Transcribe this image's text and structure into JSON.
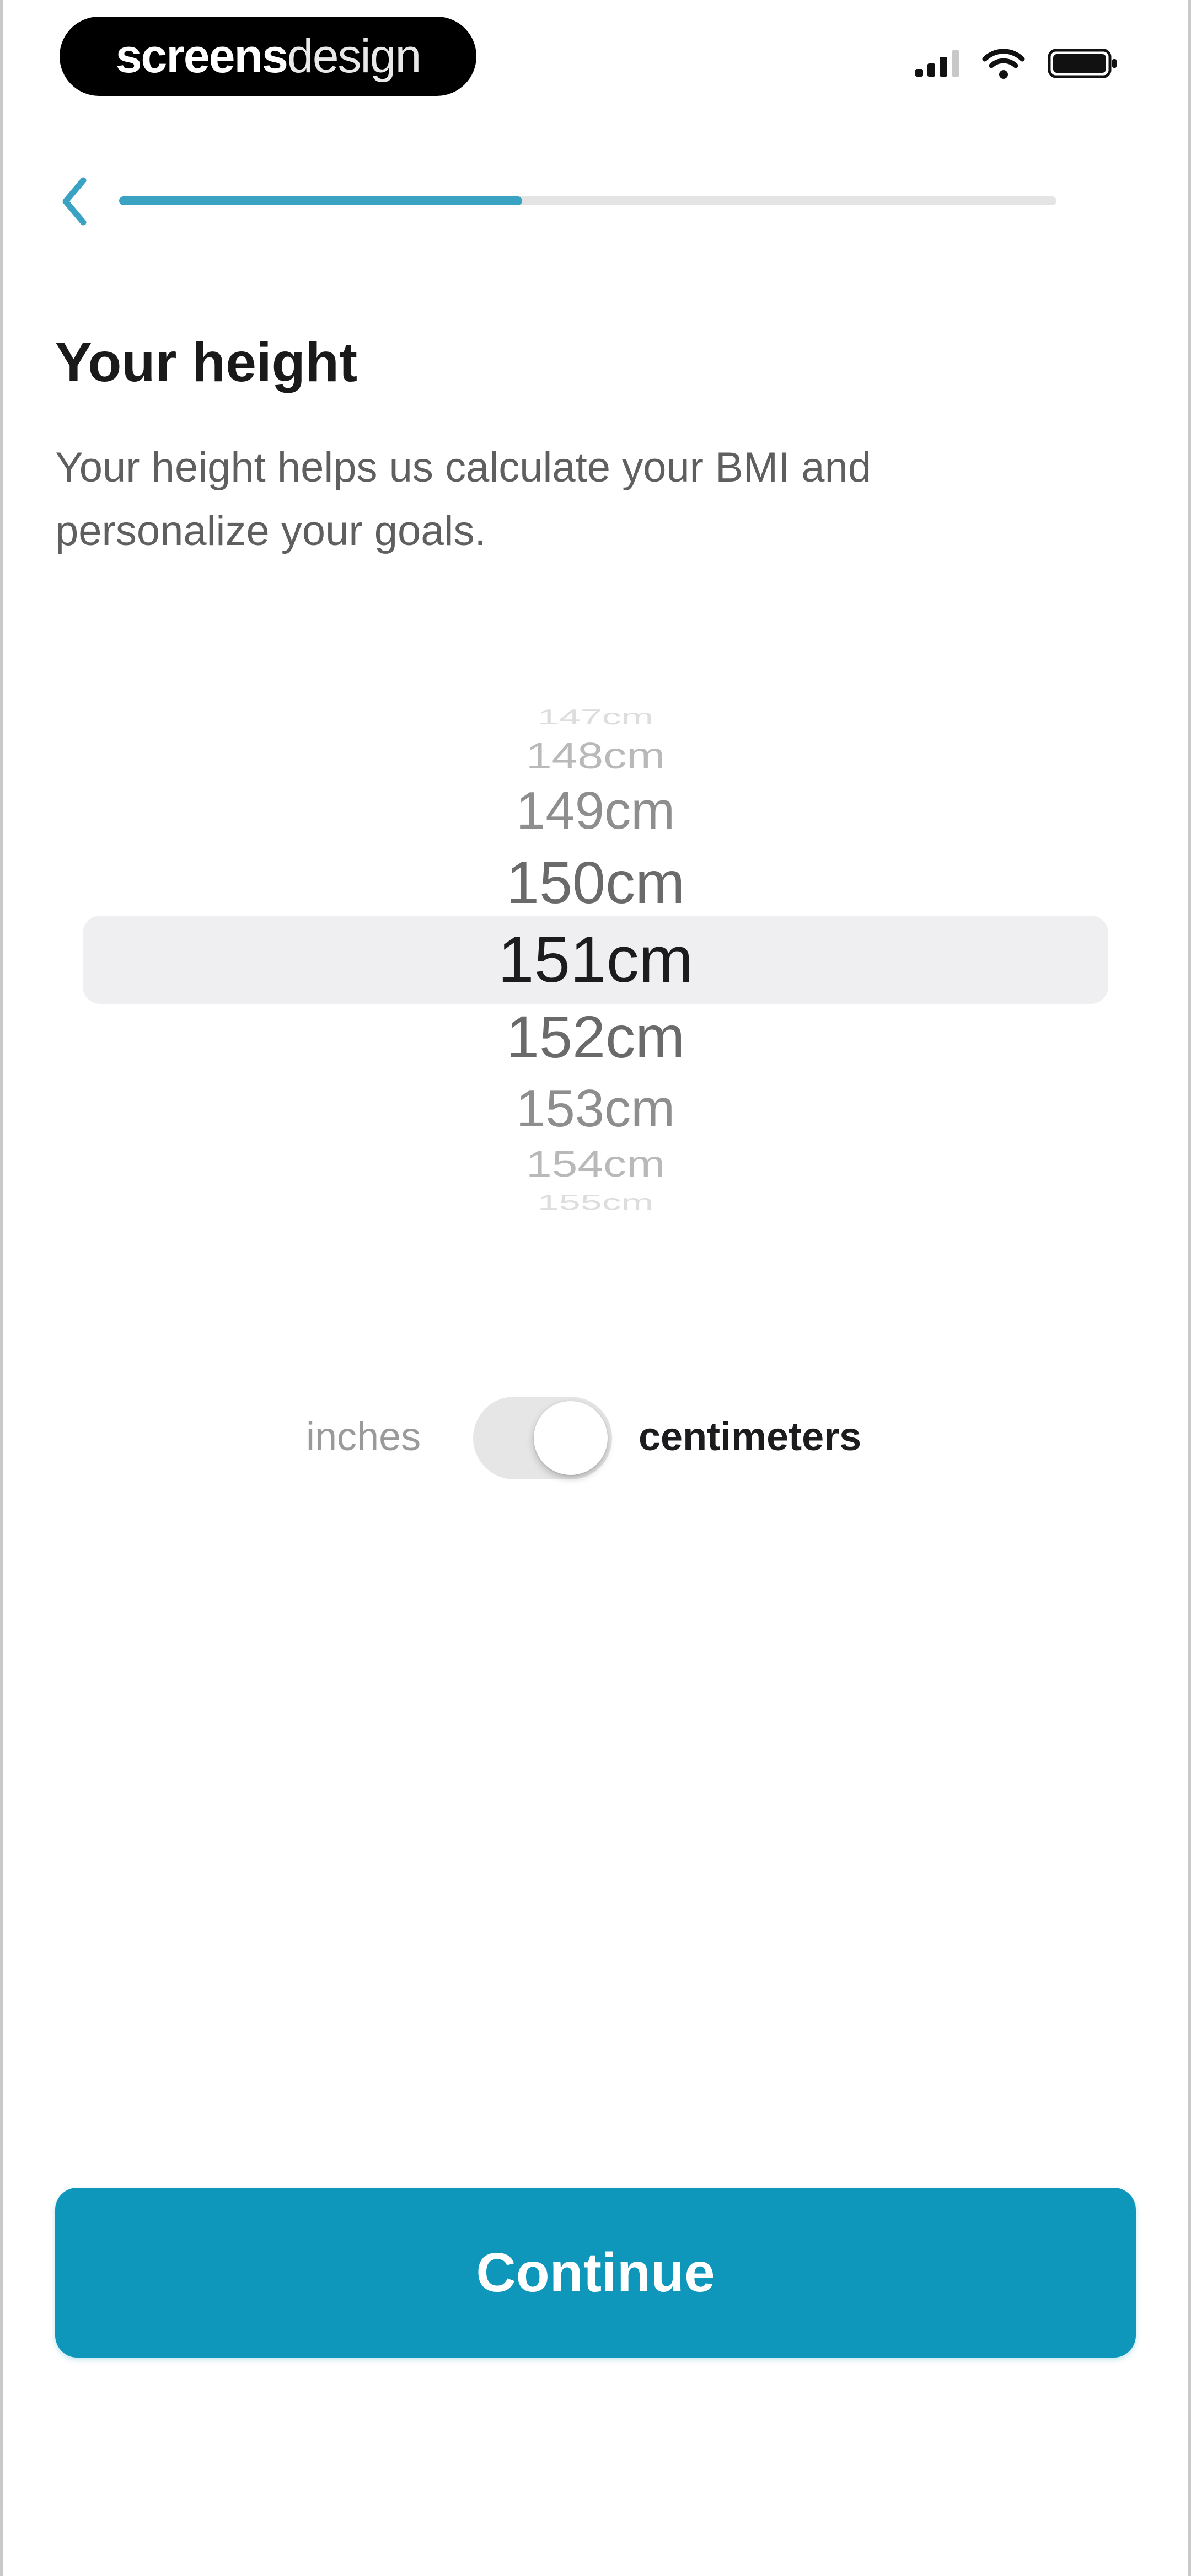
{
  "status_bar": {
    "brand_bold": "screens",
    "brand_regular": "design",
    "signal_icon": "cellular-signal-icon",
    "wifi_icon": "wifi-icon",
    "battery_icon": "battery-icon"
  },
  "nav": {
    "back_icon": "chevron-left-icon",
    "progress_fraction": 0.43,
    "accent_color": "#3aa3c4"
  },
  "content": {
    "title": "Your height",
    "description": "Your height helps us calculate your BMI and personalize your goals."
  },
  "picker": {
    "items": [
      "147cm",
      "148cm",
      "149cm",
      "150cm",
      "151cm",
      "152cm",
      "153cm",
      "154cm",
      "155cm"
    ],
    "selected": "151cm",
    "selected_index": 4
  },
  "units": {
    "left_label": "inches",
    "right_label": "centimeters",
    "active": "centimeters"
  },
  "continue_button": {
    "label": "Continue",
    "color": "#0e97bb"
  }
}
